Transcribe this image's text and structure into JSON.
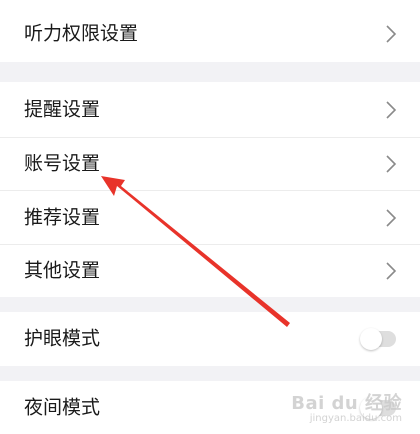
{
  "sections": [
    {
      "items": [
        {
          "label": "听力权限设置",
          "control": "chevron"
        }
      ]
    },
    {
      "items": [
        {
          "label": "提醒设置",
          "control": "chevron"
        },
        {
          "label": "账号设置",
          "control": "chevron"
        },
        {
          "label": "推荐设置",
          "control": "chevron"
        },
        {
          "label": "其他设置",
          "control": "chevron"
        }
      ]
    },
    {
      "items": [
        {
          "label": "护眼模式",
          "control": "toggle",
          "on": false
        }
      ]
    },
    {
      "items": [
        {
          "label": "夜间模式",
          "control": "toggle",
          "on": false
        }
      ]
    }
  ],
  "annotation": {
    "type": "red-arrow",
    "points_to": "账号设置",
    "color": "#e8332a"
  },
  "watermark": {
    "brand": "Bai du 经验",
    "sub": "jingyan.baidu.com"
  },
  "colors": {
    "background": "#f5f5f7",
    "row": "#ffffff",
    "toggle_off": "#dedede",
    "chevron": "#8a8a8a"
  }
}
